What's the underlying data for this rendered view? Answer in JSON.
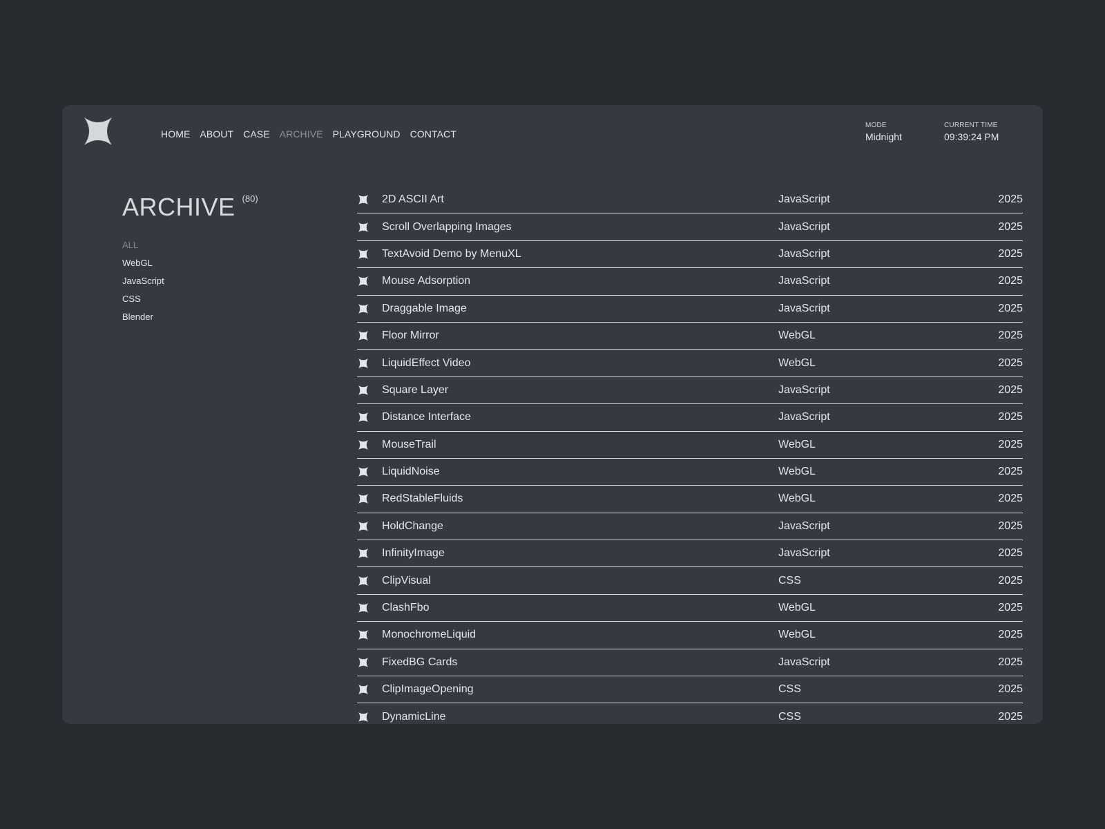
{
  "brand": {
    "logo_icon": "four-point-star-icon"
  },
  "nav": {
    "items": [
      {
        "label": "HOME",
        "active": false
      },
      {
        "label": "ABOUT",
        "active": false
      },
      {
        "label": "CASE",
        "active": false
      },
      {
        "label": "ARCHIVE",
        "active": true
      },
      {
        "label": "PLAYGROUND",
        "active": false
      },
      {
        "label": "CONTACT",
        "active": false
      }
    ]
  },
  "meta": {
    "mode_label": "MODE",
    "mode_value": "Midnight",
    "time_label": "CURRENT TIME",
    "time_value": "09:39:24 PM"
  },
  "archive": {
    "title": "ARCHIVE",
    "count": "(80)",
    "filters": [
      {
        "label": "ALL",
        "active": true
      },
      {
        "label": "WebGL",
        "active": false
      },
      {
        "label": "JavaScript",
        "active": false
      },
      {
        "label": "CSS",
        "active": false
      },
      {
        "label": "Blender",
        "active": false
      }
    ],
    "items": [
      {
        "name": "2D ASCII Art",
        "category": "JavaScript",
        "year": "2025"
      },
      {
        "name": "Scroll Overlapping Images",
        "category": "JavaScript",
        "year": "2025"
      },
      {
        "name": "TextAvoid Demo by MenuXL",
        "category": "JavaScript",
        "year": "2025"
      },
      {
        "name": "Mouse Adsorption",
        "category": "JavaScript",
        "year": "2025"
      },
      {
        "name": "Draggable Image",
        "category": "JavaScript",
        "year": "2025"
      },
      {
        "name": "Floor Mirror",
        "category": "WebGL",
        "year": "2025"
      },
      {
        "name": "LiquidEffect Video",
        "category": "WebGL",
        "year": "2025"
      },
      {
        "name": "Square Layer",
        "category": "JavaScript",
        "year": "2025"
      },
      {
        "name": "Distance Interface",
        "category": "JavaScript",
        "year": "2025"
      },
      {
        "name": "MouseTrail",
        "category": "WebGL",
        "year": "2025"
      },
      {
        "name": "LiquidNoise",
        "category": "WebGL",
        "year": "2025"
      },
      {
        "name": "RedStableFluids",
        "category": "WebGL",
        "year": "2025"
      },
      {
        "name": "HoldChange",
        "category": "JavaScript",
        "year": "2025"
      },
      {
        "name": "InfinityImage",
        "category": "JavaScript",
        "year": "2025"
      },
      {
        "name": "ClipVisual",
        "category": "CSS",
        "year": "2025"
      },
      {
        "name": "ClashFbo",
        "category": "WebGL",
        "year": "2025"
      },
      {
        "name": "MonochromeLiquid",
        "category": "WebGL",
        "year": "2025"
      },
      {
        "name": "FixedBG Cards",
        "category": "JavaScript",
        "year": "2025"
      },
      {
        "name": "ClipImageOpening",
        "category": "CSS",
        "year": "2025"
      },
      {
        "name": "DynamicLine",
        "category": "CSS",
        "year": "2025"
      }
    ],
    "item_icon": "star-icon"
  },
  "colors": {
    "page_bg": "#252b2f",
    "panel_bg": "#343a40",
    "text": "#e4e7ea",
    "muted": "#80878d"
  }
}
